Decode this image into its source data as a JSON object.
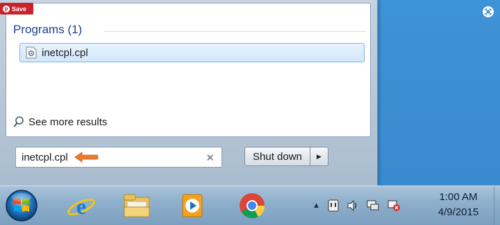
{
  "save_badge": {
    "label": "Save",
    "icon": "pinterest-icon",
    "color": "#c8232c"
  },
  "start_menu": {
    "group_heading": "Programs (1)",
    "results": [
      {
        "label": "inetcpl.cpl",
        "icon": "control-panel-file-icon"
      }
    ],
    "see_more": {
      "label": "See more results",
      "icon": "search-icon"
    },
    "search": {
      "value": "inetcpl.cpl",
      "clear_icon": "clear-icon",
      "annotation_icon": "orange-arrow-icon"
    },
    "shutdown": {
      "label": "Shut down",
      "options_icon": "triangle-right-icon"
    }
  },
  "taskbar": {
    "start_button_icon": "windows-orb-icon",
    "pinned": [
      {
        "name": "internet-explorer-icon"
      },
      {
        "name": "file-explorer-icon"
      },
      {
        "name": "media-player-icon"
      },
      {
        "name": "chrome-icon"
      }
    ],
    "tray": {
      "chevron": "▲",
      "icons": [
        "network-plug-icon",
        "speaker-icon",
        "display-icon",
        "action-center-icon"
      ]
    },
    "clock": {
      "time": "1:00 AM",
      "date": "4/9/2015"
    }
  },
  "desktop": {
    "corner_icon": "fullscreen-icon"
  },
  "colors": {
    "desktop": "#3d8fd1",
    "heading": "#1e3f8f",
    "selection_border": "#7eb4ea"
  }
}
